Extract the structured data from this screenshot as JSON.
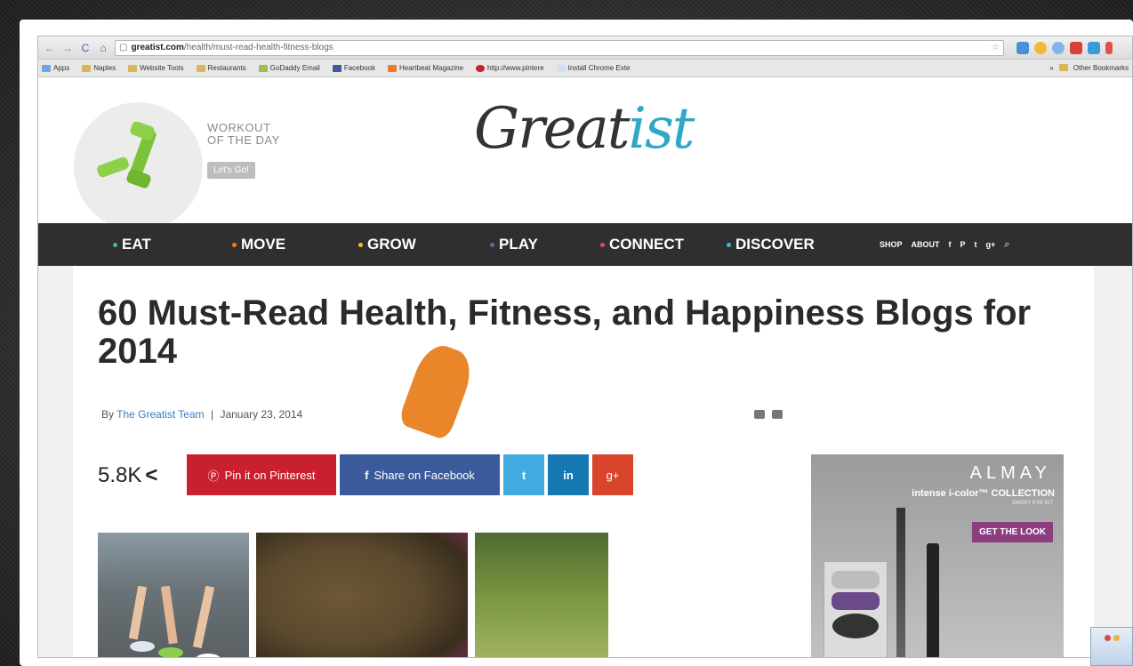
{
  "browser": {
    "url_domain": "greatist.com",
    "url_path": "/health/must-read-health-fitness-blogs"
  },
  "bookmarks": {
    "items": [
      "Apps",
      "Naples",
      "Website Tools",
      "Restaurants",
      "GoDaddy Email",
      "Facebook",
      "Heartbeat Magazine",
      "http://www.pintere",
      "Install Chrome Exte"
    ],
    "other": "Other Bookmarks"
  },
  "header": {
    "wod_line1": "WORKOUT",
    "wod_line2": "OF THE DAY",
    "wod_button": "Let's Go!",
    "logo_main": "Great",
    "logo_accent": "ist"
  },
  "nav": {
    "items": [
      {
        "label": "EAT",
        "color": "#3fb6a8"
      },
      {
        "label": "MOVE",
        "color": "#f07a2b"
      },
      {
        "label": "GROW",
        "color": "#f2c018"
      },
      {
        "label": "PLAY",
        "color": "#7b5aa6"
      },
      {
        "label": "CONNECT",
        "color": "#d9428c"
      },
      {
        "label": "DISCOVER",
        "color": "#41b6d6"
      }
    ],
    "shop": "SHOP",
    "about": "ABOUT",
    "social": [
      "f",
      "P",
      "t",
      "g+"
    ]
  },
  "article": {
    "title": "60 Must-Read Health, Fitness, and Happiness Blogs for 2014",
    "by": "By",
    "author": "The Greatist Team",
    "separator": "|",
    "date": "January 23, 2014",
    "share_count": "5.8K",
    "pin_label": "Pin it on Pinterest",
    "fb_label": "Share on Facebook",
    "tw_label": "t",
    "li_label": "in",
    "gp_label": "g+"
  },
  "ad": {
    "brand": "ALMAY",
    "line1": "intense i-color™ COLLECTION",
    "line2": "SMOKY EYE KIT",
    "cta": "GET THE LOOK"
  }
}
